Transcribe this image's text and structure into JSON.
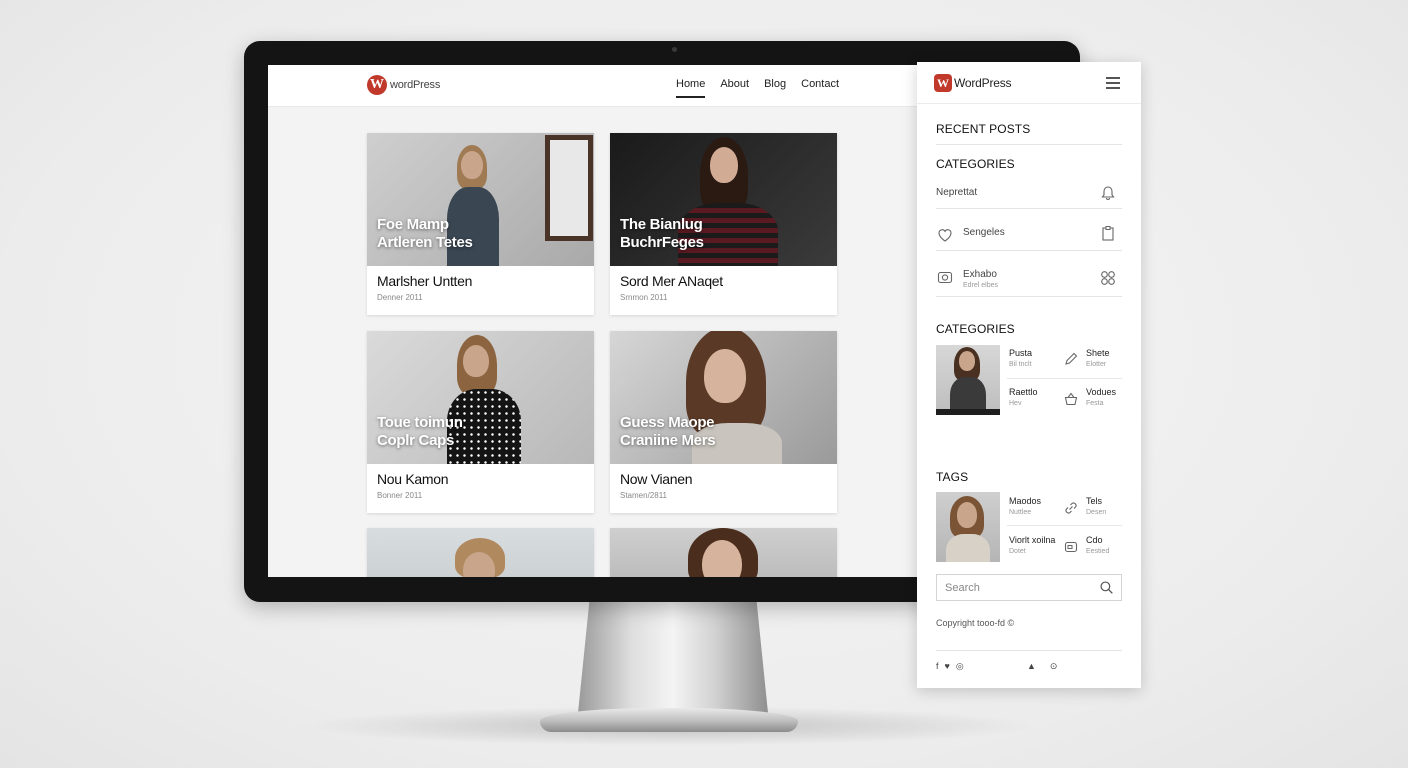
{
  "site": {
    "logo_text": "wordPress",
    "logo_mark": "W",
    "nav": [
      "Home",
      "About",
      "Blog",
      "Contact"
    ],
    "active_nav": "Home"
  },
  "posts": [
    {
      "overlay": "Foe Mamp\nArtleren Tetes",
      "title": "Marlsher Untten",
      "date": "Denner 2011"
    },
    {
      "overlay": "The Bianlug\nBuchrFeges",
      "title": "Sord Mer ANaqet",
      "date": "Srnmon 2011"
    },
    {
      "overlay": "Toue toimun\nCoplr Caps",
      "title": "Nou Kamon",
      "date": "Bonner 2011"
    },
    {
      "overlay": "Guess Maope\nCraniine Mers",
      "title": "Now Vianen",
      "date": "Stamen/2811"
    }
  ],
  "panel": {
    "logo_text": "WordPress",
    "logo_mark": "W",
    "recent_posts": "RECENT POSTS",
    "categories_1": "CATEGORIES",
    "cat_items": [
      {
        "label": "Neprettat",
        "sub": ""
      },
      {
        "label": "Sengeles",
        "sub": ""
      },
      {
        "label": "Exhabo",
        "sub": "Edrel elbes"
      }
    ],
    "categories_2": "CATEGORIES",
    "cat_grid": [
      {
        "title": "Pusta",
        "sub": "Bil tnclt"
      },
      {
        "title": "Shete",
        "sub": "Elotter"
      },
      {
        "title": "Raettlo",
        "sub": "Hev"
      },
      {
        "title": "Vodues",
        "sub": "Festa"
      }
    ],
    "tags": "TAGS",
    "tag_grid": [
      {
        "title": "Maodos",
        "sub": "Nuttlee"
      },
      {
        "title": "Tels",
        "sub": "Desen"
      },
      {
        "title": "Viorlt xoilna",
        "sub": "Dotet"
      },
      {
        "title": "Cdo",
        "sub": "Eestied"
      }
    ],
    "search_placeholder": "Search",
    "copyright": "Copyright tooo-fd  ©",
    "social_left": [
      "f",
      "♥",
      "◎"
    ],
    "social_right": [
      "▲",
      "⊙"
    ]
  }
}
